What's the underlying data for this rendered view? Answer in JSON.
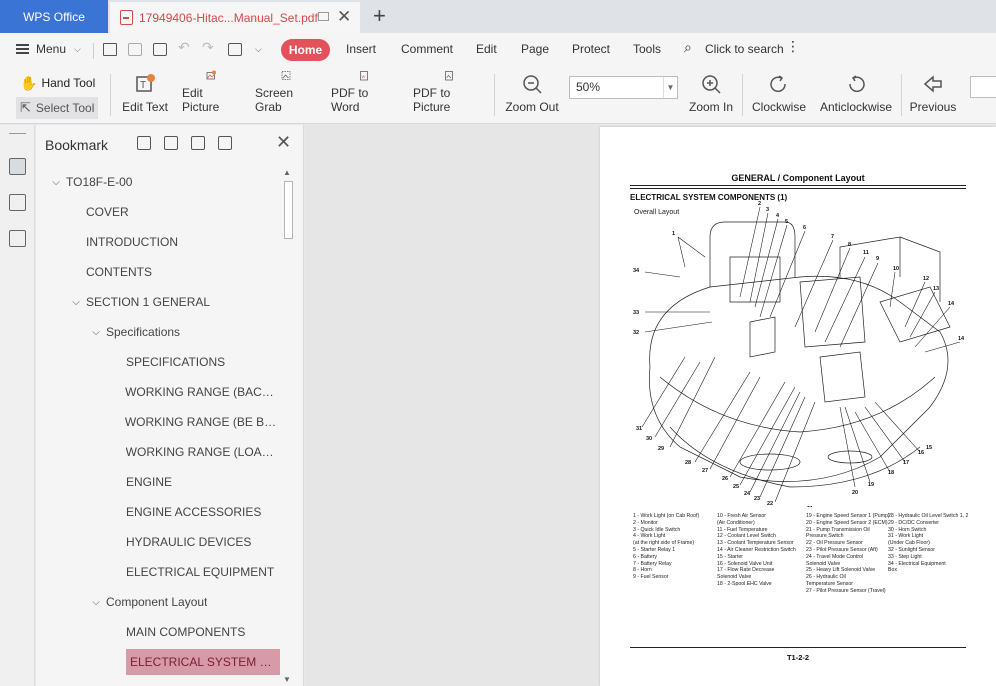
{
  "titlebar": {
    "app_tab": "WPS Office",
    "doc_tab": "17949406-Hitac...Manual_Set.pdf"
  },
  "menu": {
    "menu_label": "Menu",
    "tabs": [
      "Home",
      "Insert",
      "Comment",
      "Edit",
      "Page",
      "Protect",
      "Tools"
    ],
    "search": "Click to search"
  },
  "toolbar": {
    "hand_tool": "Hand Tool",
    "select_tool": "Select Tool",
    "edit_text": "Edit Text",
    "edit_picture": "Edit Picture",
    "screen_grab": "Screen Grab",
    "pdf_to_word": "PDF to Word",
    "pdf_to_picture": "PDF to Picture",
    "zoom_out": "Zoom Out",
    "zoom_value": "50%",
    "zoom_in": "Zoom In",
    "clockwise": "Clockwise",
    "anticlockwise": "Anticlockwise",
    "previous": "Previous"
  },
  "bookmark": {
    "title": "Bookmark",
    "items": [
      {
        "label": "TO18F-E-00",
        "level": 0,
        "expanded": true
      },
      {
        "label": "COVER",
        "level": 1
      },
      {
        "label": "INTRODUCTION",
        "level": 1
      },
      {
        "label": "CONTENTS",
        "level": 1
      },
      {
        "label": "SECTION 1 GENERAL",
        "level": 1,
        "expanded": true
      },
      {
        "label": "Specifications",
        "level": 2,
        "expanded": true
      },
      {
        "label": "SPECIFICATIONS",
        "level": 3
      },
      {
        "label": "WORKING RANGE (BACKH...",
        "level": 3
      },
      {
        "label": "WORKING RANGE (BE BAC...",
        "level": 3
      },
      {
        "label": "WORKING RANGE (LOADI...",
        "level": 3
      },
      {
        "label": "ENGINE",
        "level": 3
      },
      {
        "label": "ENGINE ACCESSORIES",
        "level": 3
      },
      {
        "label": "HYDRAULIC DEVICES",
        "level": 3
      },
      {
        "label": "ELECTRICAL EQUIPMENT",
        "level": 3
      },
      {
        "label": "Component Layout",
        "level": 2,
        "expanded": true
      },
      {
        "label": "MAIN COMPONENTS",
        "level": 3
      },
      {
        "label": "ELECTRICAL SYSTEM COM...",
        "level": 3,
        "selected": true
      }
    ]
  },
  "page": {
    "header": "GENERAL / Component Layout",
    "subtitle": "ELECTRICAL SYSTEM COMPONENTS (1)",
    "overall": "Overall Layout",
    "footer": "T1-2-2",
    "legend_col1": [
      "1 -  Work Light (on Cab Roof)",
      "2 -  Monitor",
      "3 -  Quick Idle Switch",
      "4 -  Work Light",
      "     (at the right side of Frame)",
      "5 -  Starter Relay 1",
      "6 -  Battery",
      "7 -  Battery Relay",
      "8 -  Horn",
      "9 -  Fuel Sensor"
    ],
    "legend_col2": [
      "10 -  Fresh Air Sensor",
      "      (Air Conditioner)",
      "11 -  Fuel Temperature",
      "12 -  Coolant Level Switch",
      "13 -  Coolant Temperature Sensor",
      "14 -  Air Cleaner Restriction Switch",
      "15 -  Starter",
      "16 -  Solenoid Valve Unit",
      "17 -  Flow Rate Decrease",
      "      Solenoid Valve",
      "18 -  2-Spool EHC Valve"
    ],
    "legend_col3": [
      "19 -  Engine Speed Sensor 1 (Pump)",
      "20 -  Engine Speed Sensor 2 (ECM)",
      "21 -  Pump Transmission Oil",
      "      Pressure Switch",
      "22 -  Oil Pressure Sensor",
      "23 -  Pilot Pressure Sensor (Aft)",
      "24 -  Travel Mode Control",
      "      Solenoid Valve",
      "25 -  Heavy Lift Solenoid Valve",
      "26 -  Hydraulic Oil",
      "      Temperature Sensor",
      "27 -  Pilot Pressure Sensor (Travel)"
    ],
    "legend_col4": [
      "28 -  Hydraulic Oil Level Switch 1, 2",
      "29 -  DC/DC Converter",
      "30 -  Horn Switch",
      "31 -  Work Light",
      "      (Under Cab Floor)",
      "32 -  Sunlight Sensor",
      "33 -  Step Light",
      "34 -  Electrical Equipment",
      "      Box"
    ]
  }
}
